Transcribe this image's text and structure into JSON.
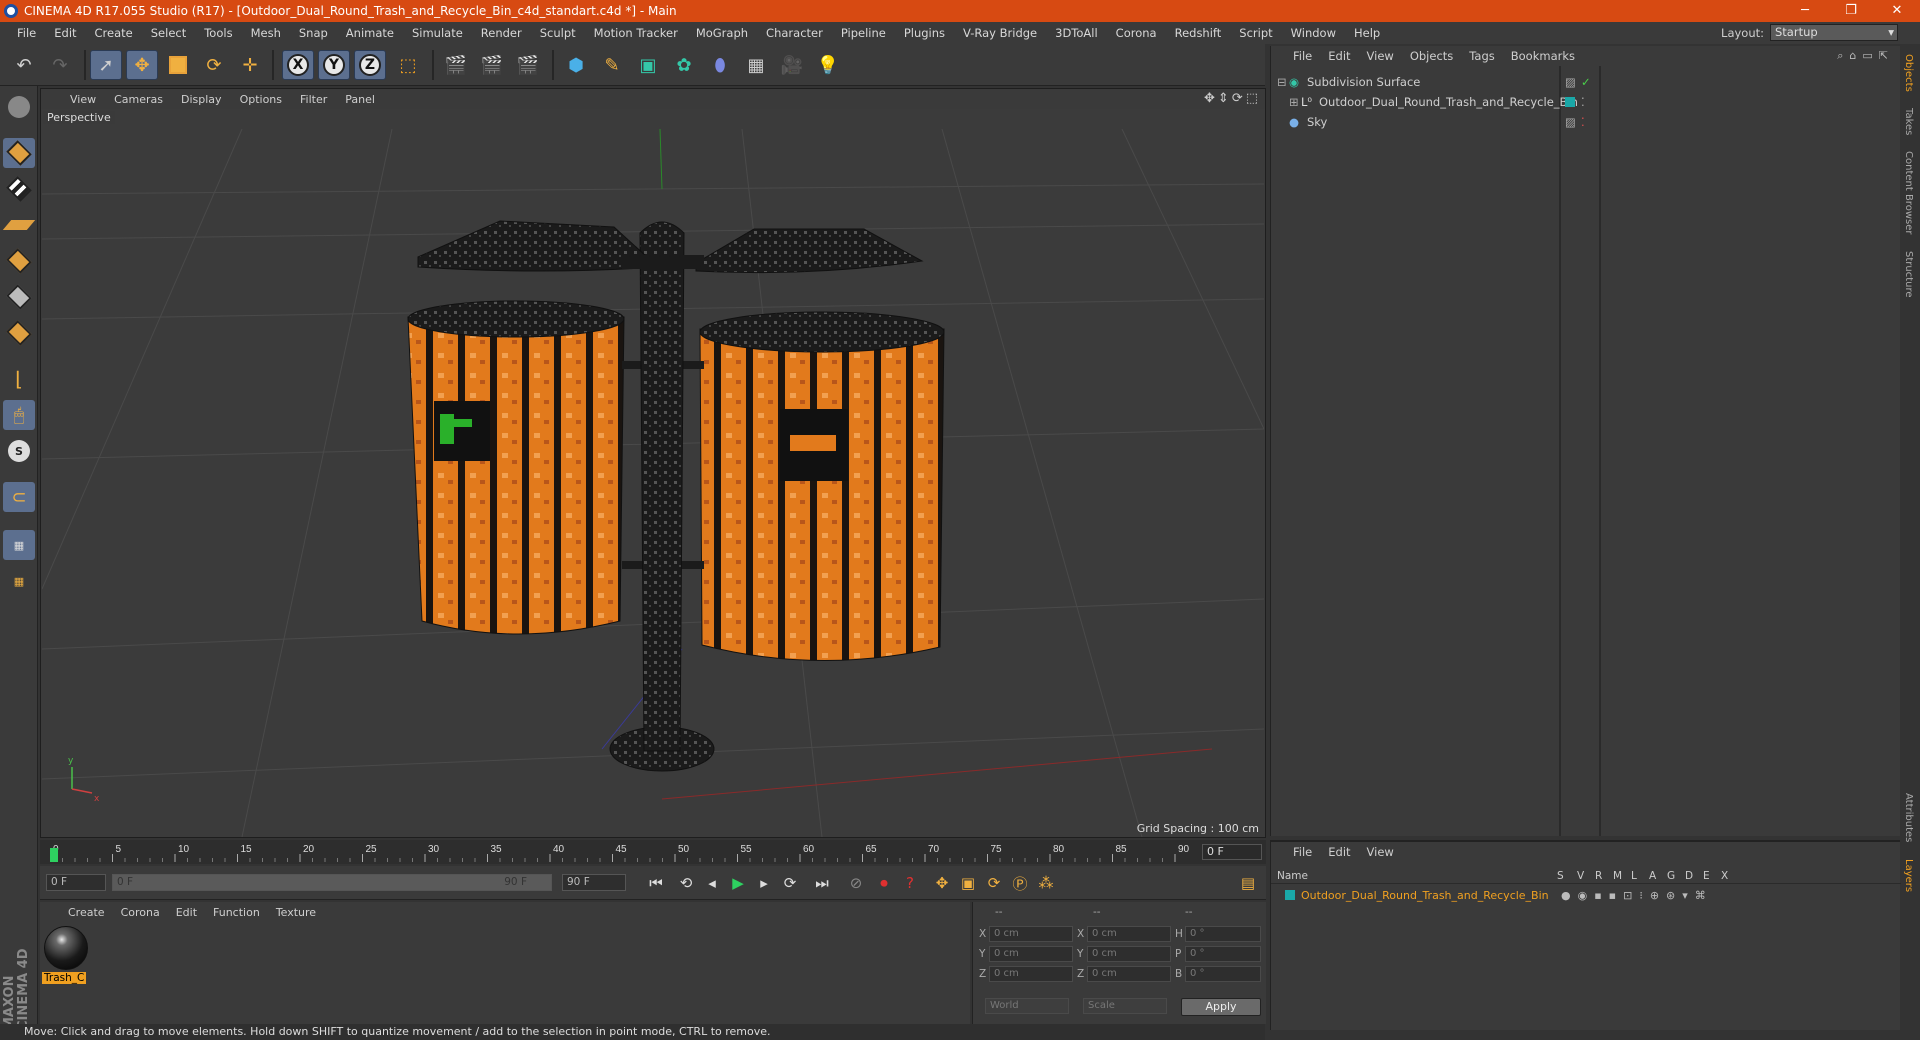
{
  "window": {
    "title": "CINEMA 4D R17.055 Studio (R17) - [Outdoor_Dual_Round_Trash_and_Recycle_Bin_c4d_standart.c4d *] - Main"
  },
  "menu": [
    "File",
    "Edit",
    "Create",
    "Select",
    "Tools",
    "Mesh",
    "Snap",
    "Animate",
    "Simulate",
    "Render",
    "Sculpt",
    "Motion Tracker",
    "MoGraph",
    "Character",
    "Pipeline",
    "Plugins",
    "V-Ray Bridge",
    "3DToAll",
    "Corona",
    "Redshift",
    "Script",
    "Window",
    "Help"
  ],
  "layout": {
    "label": "Layout:",
    "value": "Startup"
  },
  "viewport": {
    "menu": [
      "View",
      "Cameras",
      "Display",
      "Options",
      "Filter",
      "Panel"
    ],
    "camera_label": "Perspective",
    "grid_spacing": "Grid Spacing : 100 cm"
  },
  "timeline": {
    "ticks": [
      "0",
      "5",
      "10",
      "15",
      "20",
      "25",
      "30",
      "35",
      "40",
      "45",
      "50",
      "55",
      "60",
      "65",
      "70",
      "75",
      "80",
      "85",
      "90"
    ],
    "current_frame": "0 F",
    "start_field": "0 F",
    "range_start": "0 F",
    "range_end": "90 F",
    "end_field": "90 F"
  },
  "material_panel": {
    "menu": [
      "Create",
      "Corona",
      "Edit",
      "Function",
      "Texture"
    ],
    "material_name": "Trash_C"
  },
  "coords": {
    "headers": [
      "--",
      "--",
      "--"
    ],
    "rows": [
      {
        "a": "X",
        "av": "0 cm",
        "b": "X",
        "bv": "0 cm",
        "c": "H",
        "cv": "0 °"
      },
      {
        "a": "Y",
        "av": "0 cm",
        "b": "Y",
        "bv": "0 cm",
        "c": "P",
        "cv": "0 °"
      },
      {
        "a": "Z",
        "av": "0 cm",
        "b": "Z",
        "bv": "0 cm",
        "c": "B",
        "cv": "0 °"
      }
    ],
    "mode": "World",
    "size_mode": "Scale",
    "apply": "Apply"
  },
  "objects_panel": {
    "menu": [
      "File",
      "Edit",
      "View",
      "Objects",
      "Tags",
      "Bookmarks"
    ],
    "items": [
      {
        "name": "Subdivision Surface",
        "color": "#9a9a9a"
      },
      {
        "name": "Outdoor_Dual_Round_Trash_and_Recycle_Bin",
        "color": "#1aa8a8"
      },
      {
        "name": "Sky",
        "color": "#9a9a9a"
      }
    ]
  },
  "side_tabs": [
    "Objects",
    "Takes",
    "Content Browser",
    "Structure",
    "Attributes",
    "Layers"
  ],
  "layers_panel": {
    "menu": [
      "File",
      "Edit",
      "View"
    ],
    "header": {
      "name": "Name",
      "cols": [
        "S",
        "V",
        "R",
        "M",
        "L",
        "A",
        "G",
        "D",
        "E",
        "X"
      ]
    },
    "layer_name": "Outdoor_Dual_Round_Trash_and_Recycle_Bin",
    "layer_color": "#1aa8a8"
  },
  "status": "Move: Click and drag to move elements. Hold down SHIFT to quantize movement / add to the selection in point mode, CTRL to remove.",
  "brand": "MAXON CINEMA 4D",
  "colors": {
    "accent": "#d74a12",
    "selected_text": "#f0a020",
    "panel": "#3a3a3a"
  }
}
